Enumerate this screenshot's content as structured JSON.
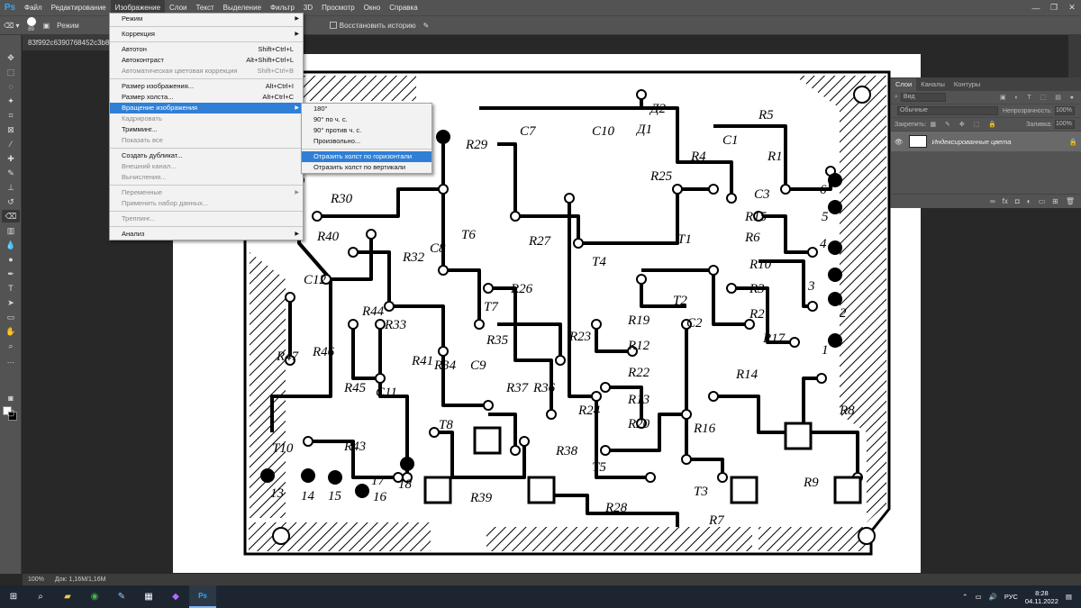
{
  "app": {
    "logo": "Ps"
  },
  "menubar": {
    "items": [
      "Файл",
      "Редактирование",
      "Изображение",
      "Слои",
      "Текст",
      "Выделение",
      "Фильтр",
      "3D",
      "Просмотр",
      "Окно",
      "Справка"
    ],
    "window_controls": [
      "—",
      "❐",
      "✕"
    ]
  },
  "options_bar": {
    "brush_size": "89",
    "mode_label": "Режим",
    "restore_history_label": "Восстановить историю"
  },
  "document": {
    "tab_title": "83f992c6390768452c3b80e3",
    "zoom": "100%",
    "doc_info": "Док: 1,16M/1,16M"
  },
  "image_menu": {
    "items": [
      {
        "label": "Режим",
        "shortcut": "",
        "disabled": false,
        "submenu": true
      },
      {
        "sep": true
      },
      {
        "label": "Коррекция",
        "shortcut": "",
        "disabled": false,
        "submenu": true
      },
      {
        "sep": true
      },
      {
        "label": "Автотон",
        "shortcut": "Shift+Ctrl+L",
        "disabled": false
      },
      {
        "label": "Автоконтраст",
        "shortcut": "Alt+Shift+Ctrl+L",
        "disabled": false
      },
      {
        "label": "Автоматическая цветовая коррекция",
        "shortcut": "Shift+Ctrl+B",
        "disabled": true
      },
      {
        "sep": true
      },
      {
        "label": "Размер изображения...",
        "shortcut": "Alt+Ctrl+I",
        "disabled": false
      },
      {
        "label": "Размер холста...",
        "shortcut": "Alt+Ctrl+C",
        "disabled": false
      },
      {
        "label": "Вращение изображения",
        "shortcut": "",
        "disabled": false,
        "submenu": true,
        "highlight": true
      },
      {
        "label": "Кадрировать",
        "shortcut": "",
        "disabled": true
      },
      {
        "label": "Тримминг...",
        "shortcut": "",
        "disabled": false
      },
      {
        "label": "Показать все",
        "shortcut": "",
        "disabled": true
      },
      {
        "sep": true
      },
      {
        "label": "Создать дубликат...",
        "shortcut": "",
        "disabled": false
      },
      {
        "label": "Внешний канал...",
        "shortcut": "",
        "disabled": true
      },
      {
        "label": "Вычисления...",
        "shortcut": "",
        "disabled": true
      },
      {
        "sep": true
      },
      {
        "label": "Переменные",
        "shortcut": "",
        "disabled": true,
        "submenu": true
      },
      {
        "label": "Применить набор данных...",
        "shortcut": "",
        "disabled": true
      },
      {
        "sep": true
      },
      {
        "label": "Треппинг...",
        "shortcut": "",
        "disabled": true
      },
      {
        "sep": true
      },
      {
        "label": "Анализ",
        "shortcut": "",
        "disabled": false,
        "submenu": true
      }
    ]
  },
  "rotate_submenu": {
    "items": [
      {
        "label": "180°"
      },
      {
        "label": "90° по ч. с."
      },
      {
        "label": "90° против ч. с."
      },
      {
        "label": "Произвольно..."
      },
      {
        "sep": true
      },
      {
        "label": "Отразить холст по горизонтали",
        "highlight": true
      },
      {
        "label": "Отразить холст по вертикали"
      }
    ]
  },
  "layers_panel": {
    "tabs": [
      "Слои",
      "Каналы",
      "Контуры"
    ],
    "search_placeholder": "Вид",
    "blend_mode": "Обычные",
    "opacity_label": "Непрозрачность:",
    "opacity_value": "100%",
    "lock_label": "Закрепить:",
    "fill_label": "Заливка:",
    "fill_value": "100%",
    "layer_name": "Индексированные цвета"
  },
  "taskbar": {
    "language": "РУС",
    "time": "8:28",
    "date": "04.11.2022"
  },
  "pcb_labels": [
    "R5",
    "Д2",
    "Д1",
    "C7",
    "C10",
    "R1",
    "C1",
    "R4",
    "R29",
    "R25",
    "C3",
    "R30",
    "R15",
    "R6",
    "T6",
    "R27",
    "T1",
    "R10",
    "R40",
    "R32",
    "C8",
    "T4",
    "R3",
    "R26",
    "T2",
    "R2",
    "C12",
    "R44",
    "R33",
    "T7",
    "R19",
    "C2",
    "R17",
    "R47",
    "R46",
    "R35",
    "R34",
    "R23",
    "R12",
    "R14",
    "R45",
    "R41",
    "R37",
    "R36",
    "R22",
    "R13",
    "R16",
    "C9",
    "C11",
    "R20",
    "T10",
    "R43",
    "T8",
    "R38",
    "R24",
    "T5",
    "R9",
    "R39",
    "R28",
    "T3",
    "R7",
    "R8",
    "13",
    "14",
    "15",
    "16",
    "17",
    "18",
    "4",
    "5",
    "6",
    "1",
    "2",
    "3"
  ]
}
